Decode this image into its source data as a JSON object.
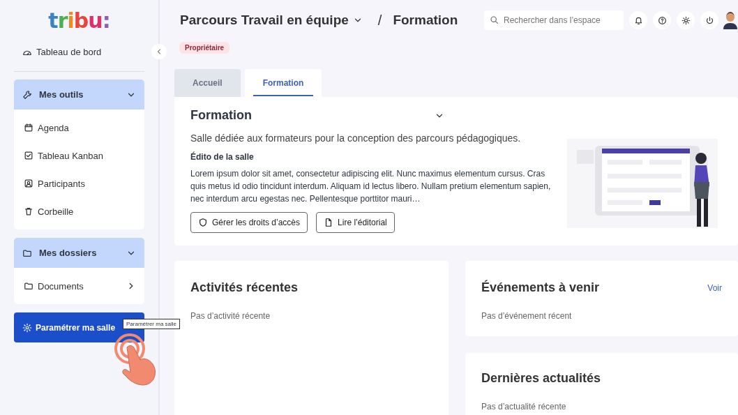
{
  "logo": {
    "text": "tribu:"
  },
  "sidebar": {
    "dashboard": "Tableau de bord",
    "groups": [
      {
        "title": "Mes outils",
        "expanded": true,
        "items": [
          {
            "label": "Agenda",
            "arrow": false
          },
          {
            "label": "Tableau Kanban",
            "arrow": false
          },
          {
            "label": "Participants",
            "arrow": false
          },
          {
            "label": "Corbeille",
            "arrow": false
          }
        ]
      },
      {
        "title": "Mes dossiers",
        "expanded": true,
        "items": [
          {
            "label": "Documents",
            "arrow": true
          }
        ]
      }
    ],
    "settings_button": "Paramétrer ma salle",
    "tooltip": "Paramétrer ma salle"
  },
  "header": {
    "space": "Parcours Travail en équipe",
    "separator": "/",
    "room": "Formation",
    "badge": "Propriétaire",
    "search": {
      "placeholder": "Rechercher dans l’espace"
    }
  },
  "tabs": [
    {
      "label": "Accueil",
      "selected": false
    },
    {
      "label": "Formation",
      "selected": true
    }
  ],
  "room_card": {
    "title": "Formation",
    "description": "Salle dédiée aux formateurs pour la conception des parcours pédagogiques.",
    "edito_title": "Édito de la salle",
    "edito": "Lorem ipsum dolor sit amet, consectetur adipiscing elit. Nunc maximus elementum cursus. Cras quis metus id odio tincidunt interdum. Aliquam id lectus libero. Nullam pretium elementum sapien, nec interdum arcu egestas nec. Pellentesque porttitor mauri…",
    "buttons": [
      {
        "label": "Gérer les droits d’accès"
      },
      {
        "label": "Lire l’éditorial"
      }
    ]
  },
  "panels": [
    {
      "title": "Activités récentes",
      "empty": "Pas d’activité récente"
    },
    {
      "title": "Événements à venir",
      "link": "Voir",
      "empty": "Pas d’événement récent"
    },
    {
      "title": "Dernières actualités",
      "empty": "Pas d’actualité récente"
    }
  ]
}
